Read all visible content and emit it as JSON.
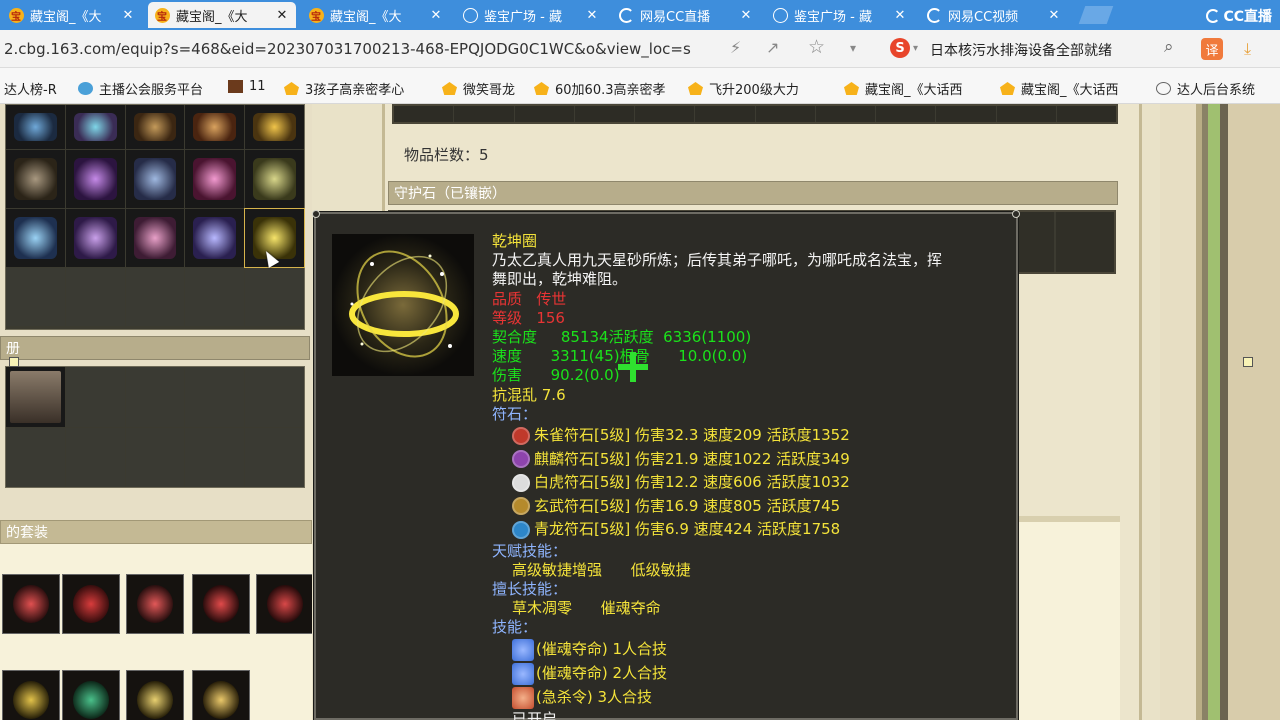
{
  "browser": {
    "tabs": [
      {
        "label": "藏宝阁_《大",
        "icon": "cbg-icon",
        "active": false
      },
      {
        "label": "藏宝阁_《大",
        "icon": "cbg-icon",
        "active": true
      },
      {
        "label": "藏宝阁_《大",
        "icon": "cbg-icon",
        "active": false
      },
      {
        "label": "鉴宝广场 - 藏",
        "icon": "globe-icon",
        "active": false
      },
      {
        "label": "网易CC直播",
        "icon": "cc-icon",
        "active": false
      },
      {
        "label": "鉴宝广场 - 藏",
        "icon": "globe-icon",
        "active": false
      },
      {
        "label": "网易CC视频",
        "icon": "cc-icon",
        "active": false
      }
    ],
    "tab_close_glyph": "✕",
    "logo_text": "CC直播",
    "url": "2.cbg.163.com/equip?s=468&eid=202307031700213-468-EPQJODG0C1WC&o&view_loc=s",
    "search_query": "日本核污水排海设备全部就绪",
    "translate_label": "译",
    "bookmarks": [
      {
        "label": "达人榜-R",
        "icon": "none"
      },
      {
        "label": "主播公会服务平台",
        "icon": "blue"
      },
      {
        "label": "11",
        "icon": "game"
      },
      {
        "label": "3孩子高亲密孝心",
        "icon": "cbg"
      },
      {
        "label": "微笑哥龙",
        "icon": "cbg"
      },
      {
        "label": "60加60.3高亲密孝",
        "icon": "cbg"
      },
      {
        "label": "飞升200级大力",
        "icon": "cbg"
      },
      {
        "label": "藏宝阁_《大话西",
        "icon": "cbg"
      },
      {
        "label": "藏宝阁_《大话西",
        "icon": "cbg"
      },
      {
        "label": "达人后台系统",
        "icon": "globe"
      }
    ]
  },
  "page": {
    "item_count_label": "物品栏数：5",
    "guard_stone_header": "守护石（已镶嵌）",
    "album_header": "册",
    "suit_header": "的套装"
  },
  "tooltip": {
    "name": "乾坤圈",
    "description": "乃太乙真人用九天星砂所炼；后传其弟子哪吒，为哪吒成名法宝，挥舞即出，乾坤难阻。",
    "quality": {
      "label": "品质",
      "value": "传世"
    },
    "level": {
      "label": "等级",
      "value": "156"
    },
    "fit": {
      "label": "契合度",
      "value": "85134"
    },
    "activity": {
      "label": "活跃度",
      "value": "6336(1100)"
    },
    "speed": {
      "label": "速度",
      "value": "3311(45)"
    },
    "hit": {
      "label": "根骨",
      "value": "10.0(0.0)"
    },
    "damage": {
      "label": "伤害",
      "value": "90.2(0.0)"
    },
    "resist": "抗混乱 7.6",
    "runes_label": "符石：",
    "runes": [
      {
        "text": "朱雀符石[5级] 伤害32.3 速度209 活跃度1352",
        "color": "#c0392b"
      },
      {
        "text": "麒麟符石[5级] 伤害21.9 速度1022 活跃度349",
        "color": "#8e44ad"
      },
      {
        "text": "白虎符石[5级] 伤害12.2 速度606 活跃度1032",
        "color": "#dcdcdc"
      },
      {
        "text": "玄武符石[5级] 伤害16.9 速度805 活跃度745",
        "color": "#b58a2c"
      },
      {
        "text": "青龙符石[5级] 伤害6.9 速度424 活跃度1758",
        "color": "#2d86c9"
      }
    ],
    "talent_label": "天赋技能：",
    "talents": [
      "高级敏捷增强",
      "低级敏捷"
    ],
    "specialty_label": "擅长技能：",
    "specialties": [
      "草木凋零",
      "催魂夺命"
    ],
    "skills_label": "技能：",
    "skills": [
      {
        "text": "(催魂夺命) 1人合技",
        "color": "#3d6fd8"
      },
      {
        "text": "(催魂夺命) 2人合技",
        "color": "#3d6fd8"
      },
      {
        "text": "(急杀令) 3人合技",
        "color": "#c44d2e"
      }
    ],
    "truncated_line": "已开启"
  },
  "colors": {
    "tab_bar": "#3e8edc",
    "tooltip_bg": "#2c2b26",
    "quality_red": "#e83434",
    "stat_green": "#1be21b",
    "rune_yellow": "#f4e33a",
    "skill_blue": "#8fb5ff"
  }
}
